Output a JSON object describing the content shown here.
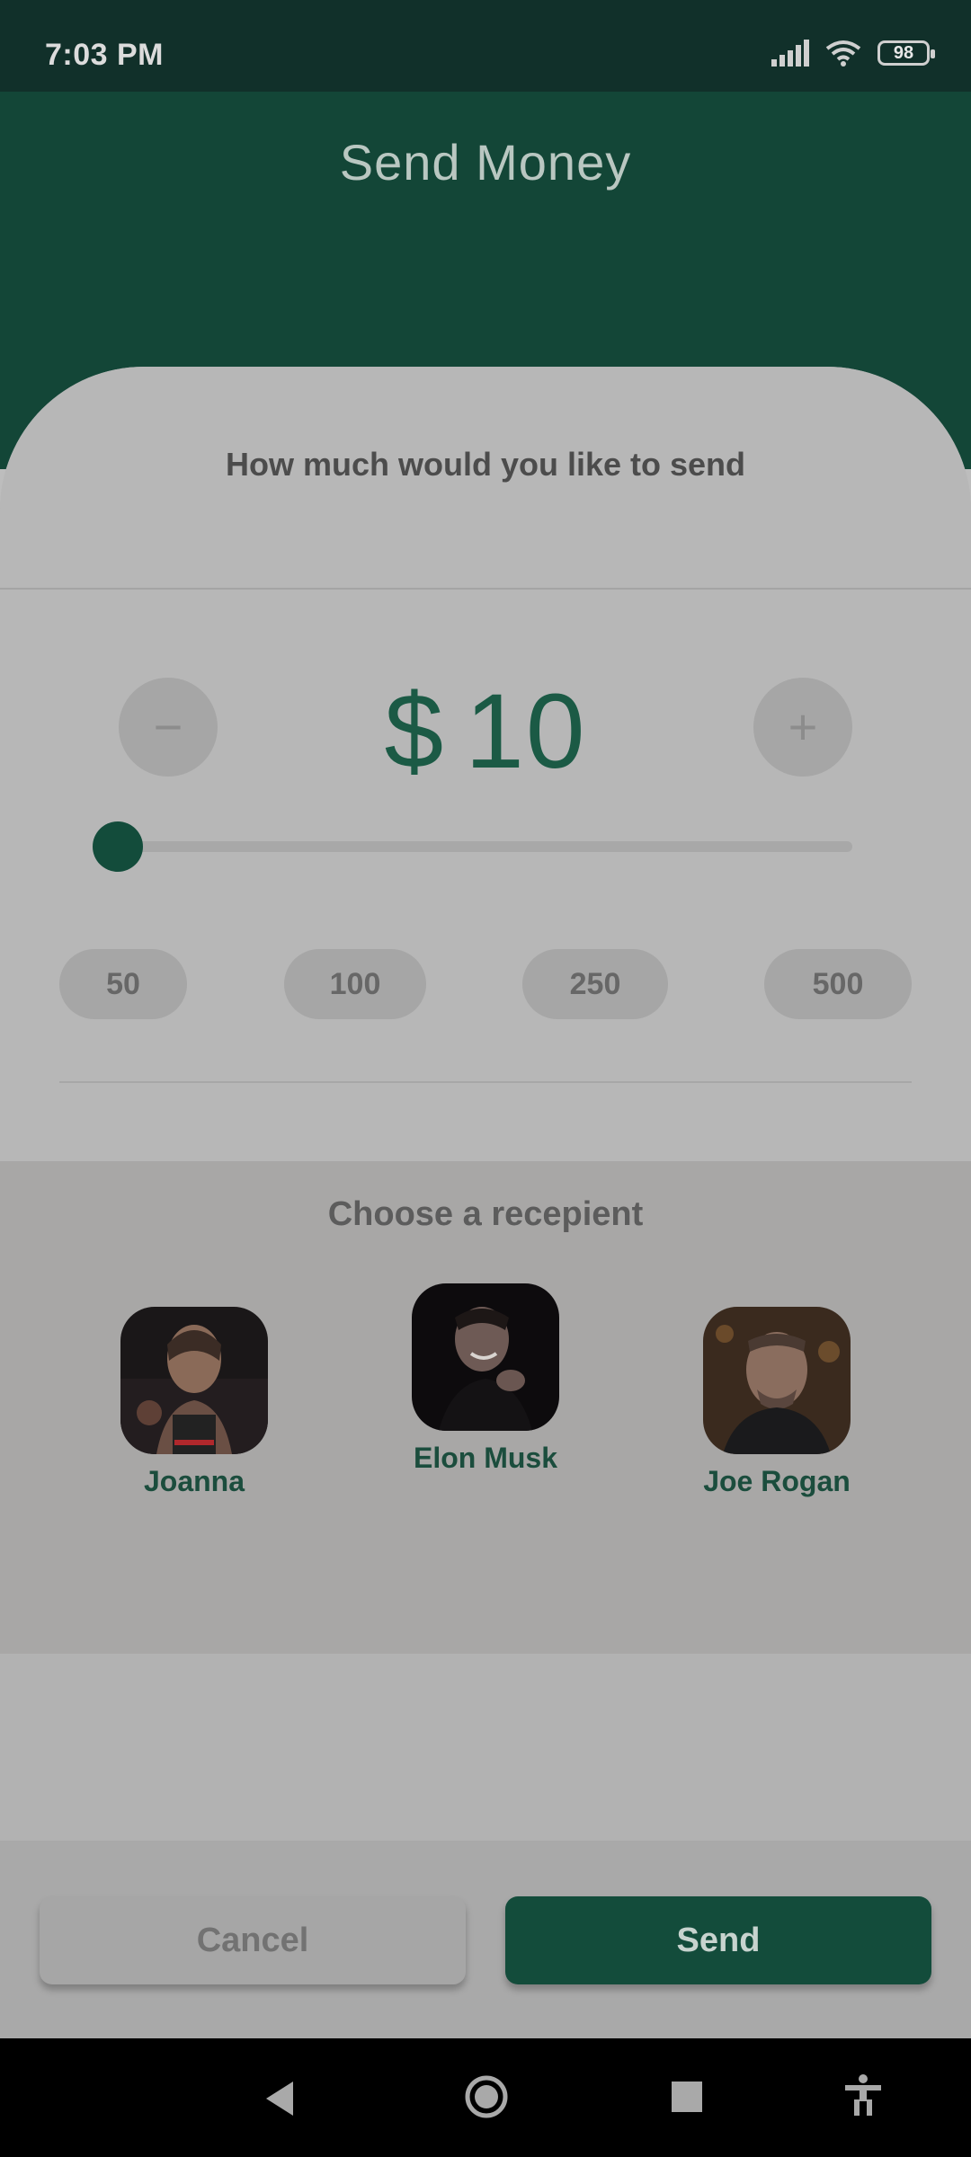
{
  "status": {
    "time": "7:03 PM",
    "battery": "98"
  },
  "header": {
    "title": "Send Money"
  },
  "amount_section": {
    "question": "How much would you like to send",
    "currency": "$",
    "amount": "10",
    "minus_label": "−",
    "plus_label": "+",
    "slider_value": 10,
    "presets": [
      "50",
      "100",
      "250",
      "500"
    ]
  },
  "recipients": {
    "title": "Choose a recepient",
    "people": [
      {
        "name": "Joanna"
      },
      {
        "name": "Elon Musk"
      },
      {
        "name": "Joe Rogan"
      }
    ]
  },
  "actions": {
    "cancel_label": "Cancel",
    "send_label": "Send"
  },
  "icons": [
    "signal-icon",
    "wifi-icon",
    "battery-icon",
    "back-icon",
    "home-icon",
    "recents-icon",
    "accessibility-icon"
  ],
  "colors": {
    "accent": "#134c3b",
    "header": "#134637"
  }
}
